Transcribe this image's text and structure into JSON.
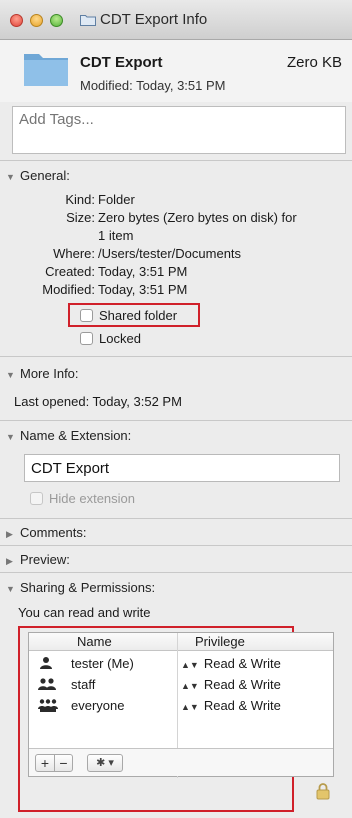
{
  "window": {
    "title": "CDT Export Info"
  },
  "header": {
    "name": "CDT Export",
    "size": "Zero KB",
    "modified": "Modified: Today, 3:51 PM"
  },
  "tags": {
    "placeholder": "Add Tags..."
  },
  "general": {
    "title": "General:",
    "rows": [
      {
        "label": "Kind:",
        "value": "Folder"
      },
      {
        "label": "Size:",
        "value": "Zero bytes (Zero bytes on disk) for"
      },
      {
        "label": "",
        "value": "1 item"
      },
      {
        "label": "Where:",
        "value": "/Users/tester/Documents"
      },
      {
        "label": "Created:",
        "value": "Today, 3:51 PM"
      },
      {
        "label": "Modified:",
        "value": "Today, 3:51 PM"
      }
    ],
    "shared_folder": "Shared folder",
    "locked": "Locked"
  },
  "more_info": {
    "title": "More Info:",
    "last_opened": "Last opened: Today, 3:52 PM"
  },
  "name_extension": {
    "title": "Name & Extension:",
    "value": "CDT Export",
    "hide_extension": "Hide extension"
  },
  "comments": {
    "title": "Comments:"
  },
  "preview": {
    "title": "Preview:"
  },
  "sharing": {
    "title": "Sharing & Permissions:",
    "status": "You can read and write",
    "col_name": "Name",
    "col_privilege": "Privilege",
    "rows": [
      {
        "name": "tester (Me)",
        "privilege": "Read & Write",
        "icon": "user-icon"
      },
      {
        "name": "staff",
        "privilege": "Read & Write",
        "icon": "group-icon"
      },
      {
        "name": "everyone",
        "privilege": "Read & Write",
        "icon": "everyone-icon"
      }
    ],
    "add_label": "+",
    "remove_label": "−",
    "gear_label": "✱ ▾"
  },
  "colors": {
    "highlight": "#d0202a",
    "folder_blue": "#7fb2dd"
  }
}
